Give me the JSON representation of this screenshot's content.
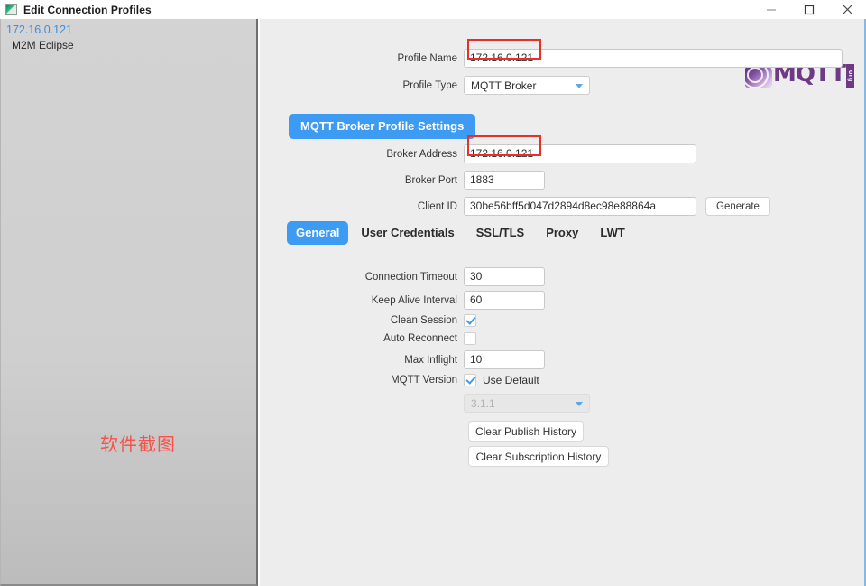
{
  "window": {
    "title": "Edit Connection Profiles",
    "icon": "app-icon",
    "minimize": "—",
    "maximize": "☐",
    "close": "✕"
  },
  "sidebar": {
    "items": [
      {
        "primary": "172.16.0.121",
        "secondary": "M2M Eclipse"
      }
    ],
    "watermark": "软件截图"
  },
  "brand": {
    "logo_text": "MQTT",
    "logo_org": "org"
  },
  "form": {
    "profile_name_label": "Profile Name",
    "profile_name_value": "172.16.0.121",
    "profile_name_placeholder": "",
    "profile_type_label": "Profile Type",
    "profile_type_value": "MQTT Broker",
    "profile_type_options": [
      "MQTT Broker"
    ],
    "section_button": "MQTT Broker Profile Settings",
    "broker_address_label": "Broker Address",
    "broker_address_value": "172.16.0.121",
    "broker_port_label": "Broker Port",
    "broker_port_value": "1883",
    "client_id_label": "Client ID",
    "client_id_value": "30be56bff5d047d2894d8ec98e88864a",
    "generate_button": "Generate"
  },
  "tabs": [
    {
      "label": "General",
      "active": true
    },
    {
      "label": "User Credentials",
      "active": false
    },
    {
      "label": "SSL/TLS",
      "active": false
    },
    {
      "label": "Proxy",
      "active": false
    },
    {
      "label": "LWT",
      "active": false
    }
  ],
  "general": {
    "connection_timeout_label": "Connection Timeout",
    "connection_timeout_value": "30",
    "keep_alive_label": "Keep Alive Interval",
    "keep_alive_value": "60",
    "clean_session_label": "Clean Session",
    "clean_session_checked": true,
    "auto_reconnect_label": "Auto Reconnect",
    "auto_reconnect_checked": false,
    "max_inflight_label": "Max Inflight",
    "max_inflight_value": "10",
    "mqtt_version_label": "MQTT Version",
    "use_default_label": "Use Default",
    "use_default_checked": true,
    "mqtt_version_value": "3.1.1",
    "mqtt_version_options": [
      "3.1.1"
    ],
    "clear_publish_history": "Clear Publish History",
    "clear_subscription_history": "Clear Subscription History"
  },
  "colors": {
    "accent": "#3d9bf3",
    "link": "#3f8ddb",
    "annotation": "#e8302a",
    "brand_purple": "#6d3a86"
  }
}
